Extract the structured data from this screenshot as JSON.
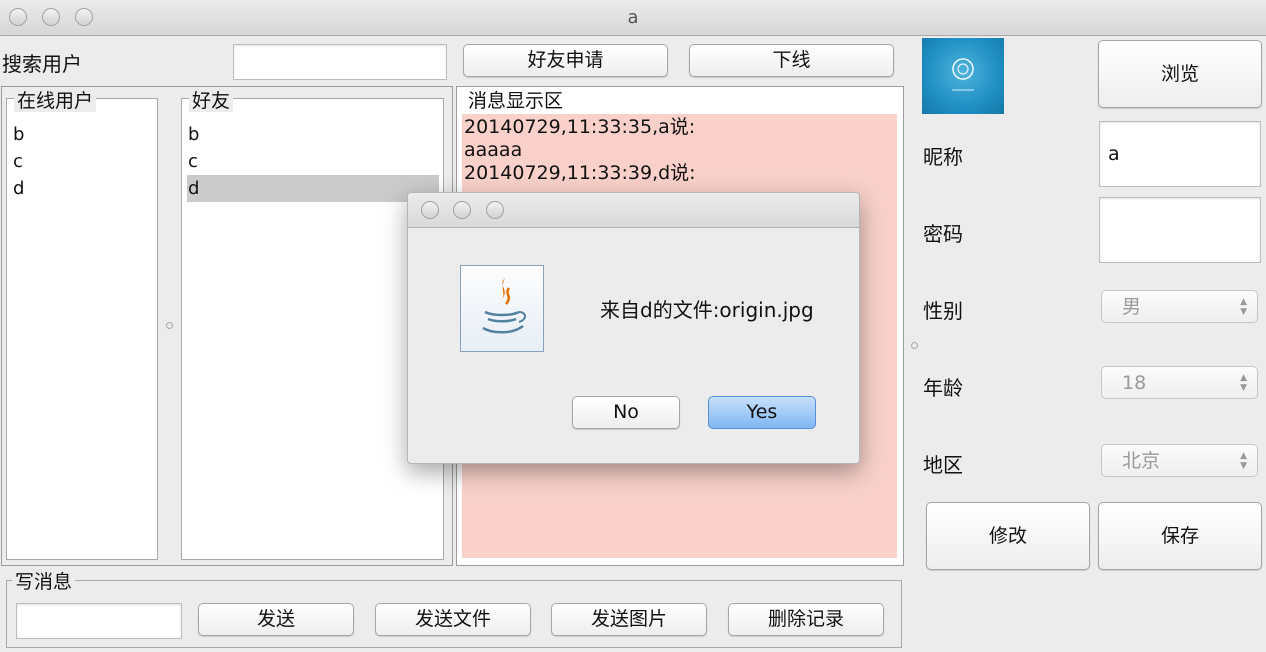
{
  "window": {
    "title": "a"
  },
  "search": {
    "label": "搜索用户",
    "value": ""
  },
  "toolbar": {
    "friend_request": "好友申请",
    "logout": "下线"
  },
  "online_users": {
    "title": "在线用户",
    "items": [
      "b",
      "c",
      "d"
    ]
  },
  "friends": {
    "title": "好友",
    "items": [
      "b",
      "c",
      "d"
    ],
    "selected": "d"
  },
  "messages": {
    "title": "消息显示区",
    "lines": [
      "20140729,11:33:35,a说:",
      "aaaaa",
      "20140729,11:33:39,d说:"
    ]
  },
  "compose": {
    "title": "写消息",
    "value": "",
    "send": "发送",
    "send_file": "发送文件",
    "send_image": "发送图片",
    "delete_history": "删除记录"
  },
  "profile": {
    "browse": "浏览",
    "nickname_label": "昵称",
    "nickname_value": "a",
    "password_label": "密码",
    "password_value": "",
    "gender_label": "性别",
    "gender_value": "男",
    "age_label": "年龄",
    "age_value": "18",
    "region_label": "地区",
    "region_value": "北京",
    "modify": "修改",
    "save": "保存"
  },
  "dialog": {
    "message": "来自d的文件:origin.jpg",
    "no": "No",
    "yes": "Yes",
    "icon": "java-coffee-icon"
  },
  "colors": {
    "message_bg": "#f9d1ca",
    "selection": "#cbcbcb",
    "default_button": "#8dbdf5"
  }
}
